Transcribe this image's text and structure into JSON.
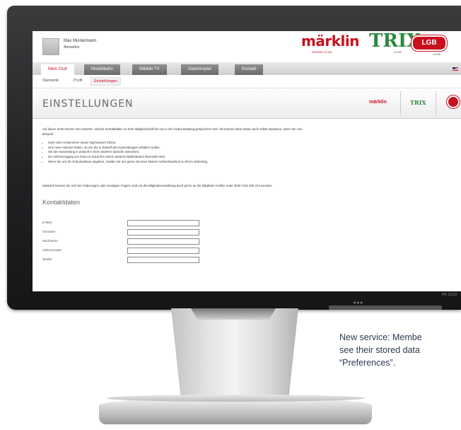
{
  "header": {
    "user_name": "Max Mustermann",
    "logout_label": "Abmelden",
    "logos": {
      "maerklin": "märklin",
      "maerklin_sub": "INSIDER CLUB",
      "trix": "TRIX",
      "trix_sub": "CLUB",
      "lgb": "LGB",
      "lgb_sub": "CLUB"
    },
    "flag_icon": "us-flag-icon"
  },
  "nav": {
    "tabs": [
      {
        "label": "Mein Club",
        "active": true
      },
      {
        "label": "Modellbahn",
        "active": false
      },
      {
        "label": "Märklin TV",
        "active": false
      },
      {
        "label": "Gewinnspiel",
        "active": false
      },
      {
        "label": "Kontakt",
        "active": false
      }
    ]
  },
  "subnav": {
    "items": [
      {
        "label": "Startseite",
        "active": false
      },
      {
        "label": "Profil",
        "active": false
      },
      {
        "label": "Einstellungen",
        "active": true
      }
    ]
  },
  "page": {
    "title": "EINSTELLUNGEN",
    "mini_logos": {
      "maerklin": "märklin",
      "trix": "TRIX"
    }
  },
  "content": {
    "intro": "Auf dieser Seite können Sie einsehen, welche Kontaktdaten zu Ihrer Mitgliedschaft bei uns in der Clubverwaltung gespeichert sind. Sie können diese Daten auch selbst anpassen, wenn Sie zum Beispiel",
    "bullets": [
      "nach einer Heirat einen neuen Nachnamen führen,",
      "eine neue Adresse haben, an der Sie in Zukunft die Aussendungen erhalten wollen,",
      "Sie die Aussendung in Zukunft in einer anderen Sprache wünschen,",
      "der Jahresvorgang von Ihnen in Zukunft in einem anderen Mailzeitraum favorisiert wird,",
      "Wenn Sie uns Ihr Geburtsdatum angeben, melden wir uns gerne mit einer kleinen Aufmerksamkeit zu Ihrem Jahrestag."
    ],
    "outro": "Natürlich können Sie sich bei Änderungen oder sonstigen Fragen rund um die Mitgliederverwaltung auch gerne an die Mitglieder Hotline unter 0049 7161 608 213 wenden.",
    "section_title": "Kontaktdaten"
  },
  "form": {
    "fields": [
      {
        "label": "E-Mail",
        "value": ""
      },
      {
        "label": "Vorname",
        "value": ""
      },
      {
        "label": "Nachname",
        "value": ""
      },
      {
        "label": "Adresszusatz",
        "value": ""
      },
      {
        "label": "Straße",
        "value": ""
      }
    ]
  },
  "monitor": {
    "brand": "HP 2229"
  },
  "caption": {
    "line1": "New service: Membe",
    "line2": "see their stored data",
    "line3": "“Preferences”."
  }
}
